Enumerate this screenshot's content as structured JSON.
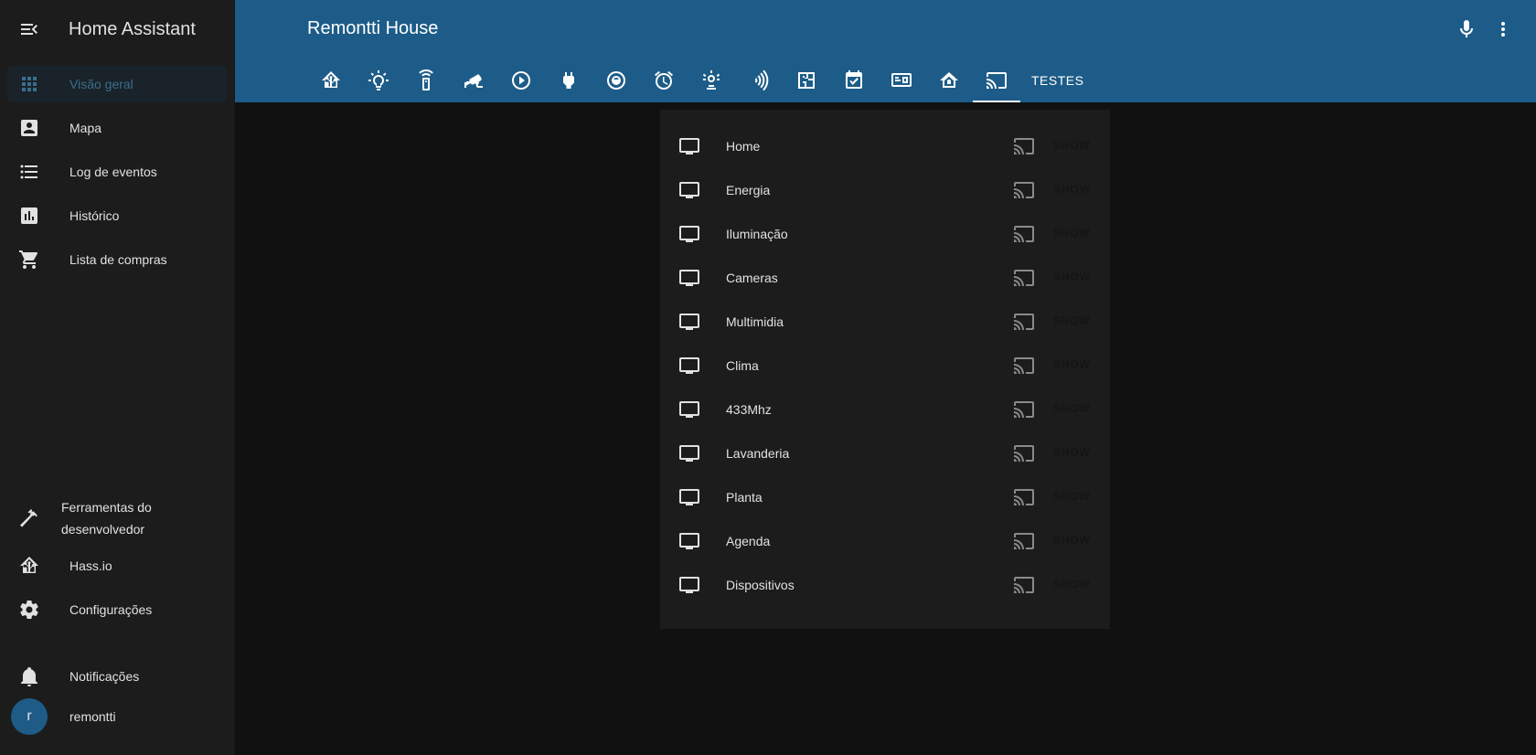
{
  "sidebar": {
    "title": "Home Assistant",
    "items": [
      {
        "label": "Visão geral",
        "icon": "grid-icon"
      },
      {
        "label": "Mapa",
        "icon": "account-box-icon"
      },
      {
        "label": "Log de eventos",
        "icon": "list-icon"
      },
      {
        "label": "Histórico",
        "icon": "chart-box-icon"
      },
      {
        "label": "Lista de compras",
        "icon": "cart-icon"
      }
    ],
    "bottom": [
      {
        "label": "Ferramentas do desenvolvedor",
        "icon": "hammer-icon"
      },
      {
        "label": "Hass.io",
        "icon": "home-assistant-icon"
      },
      {
        "label": "Configurações",
        "icon": "gear-icon"
      },
      {
        "label": "Notificações",
        "icon": "bell-icon"
      }
    ],
    "user": {
      "initial": "r",
      "name": "remontti"
    }
  },
  "header": {
    "title": "Remontti House",
    "tabs": [
      "home-assistant-icon",
      "lightbulb-icon",
      "remote-icon",
      "cctv-icon",
      "play-circle-icon",
      "power-plug-icon",
      "washing-machine-icon",
      "alarm-icon",
      "weather-icon",
      "nfc-icon",
      "floor-plan-icon",
      "calendar-check-icon",
      "devices-icon",
      "home-icon",
      "cast-icon"
    ],
    "active_tab": "cast-icon",
    "text_tab": "TESTES"
  },
  "cast_list": {
    "show_label": "SHOW",
    "items": [
      "Home",
      "Energia",
      "Iluminação",
      "Cameras",
      "Multimidia",
      "Clima",
      "433Mhz",
      "Lavanderia",
      "Planta",
      "Agenda",
      "Dispositivos"
    ]
  },
  "colors": {
    "header_bg": "#1d5c88",
    "sidebar_bg": "#1c1c1c",
    "page_bg": "#111111",
    "card_bg": "#1c1c1c",
    "active_text": "#3a6e8c"
  }
}
